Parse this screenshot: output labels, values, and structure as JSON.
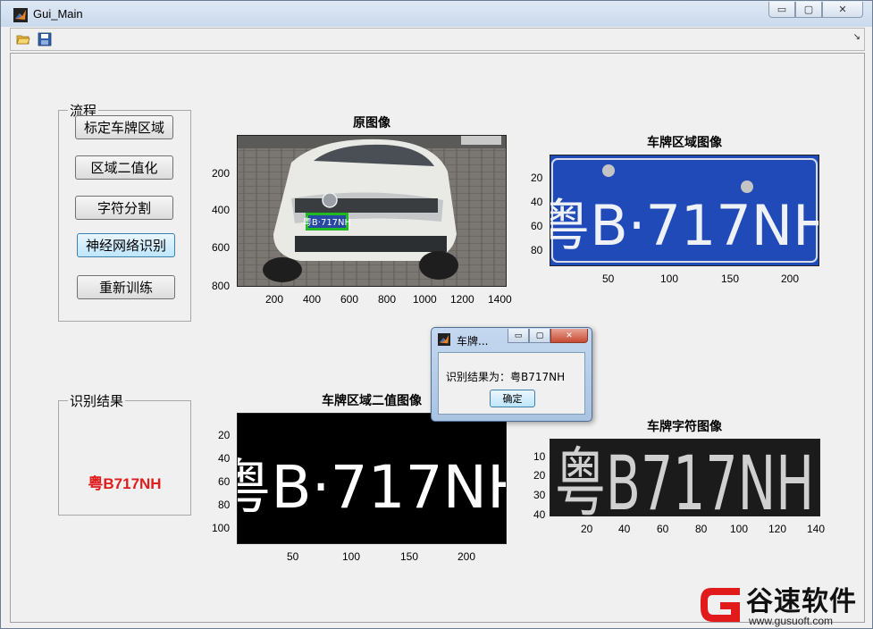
{
  "window": {
    "title": "Gui_Main",
    "controls": [
      "▭",
      "▢",
      "✕"
    ]
  },
  "toolbar": {
    "icons": [
      "open-folder-icon",
      "save-icon"
    ],
    "corner": "↘"
  },
  "panels": {
    "flow": {
      "legend": "流程",
      "buttons": [
        "标定车牌区域",
        "区域二值化",
        "字符分割",
        "神经网络识别",
        "重新训练"
      ]
    },
    "result": {
      "legend": "识别结果",
      "value": "粤B717NH",
      "value_color": "#e01c1c"
    }
  },
  "plots": {
    "original": {
      "title": "原图像",
      "xticks": [
        "200",
        "400",
        "600",
        "800",
        "1000",
        "1200",
        "1400"
      ],
      "yticks": [
        "200",
        "400",
        "600",
        "800"
      ],
      "plate_text": "粤B·717NH"
    },
    "plate_region": {
      "title": "车牌区域图像",
      "xticks": [
        "50",
        "100",
        "150",
        "200"
      ],
      "yticks": [
        "20",
        "40",
        "60",
        "80"
      ],
      "plate_text": "粤B·717NH"
    },
    "binary": {
      "title": "车牌区域二值图像",
      "xticks": [
        "50",
        "100",
        "150",
        "200"
      ],
      "yticks": [
        "20",
        "40",
        "60",
        "80",
        "100"
      ],
      "plate_text": "粤B·717NH"
    },
    "chars": {
      "title": "车牌字符图像",
      "xticks": [
        "20",
        "40",
        "60",
        "80",
        "100",
        "120",
        "140"
      ],
      "yticks": [
        "10",
        "20",
        "30",
        "40"
      ],
      "plate_text": "粤B717NH"
    }
  },
  "dialog": {
    "title": "车牌...",
    "message": "识别结果为：粤B717NH",
    "ok_label": "确定"
  },
  "watermark": {
    "text": "谷速软件",
    "url": "www.gusuoft.com"
  }
}
